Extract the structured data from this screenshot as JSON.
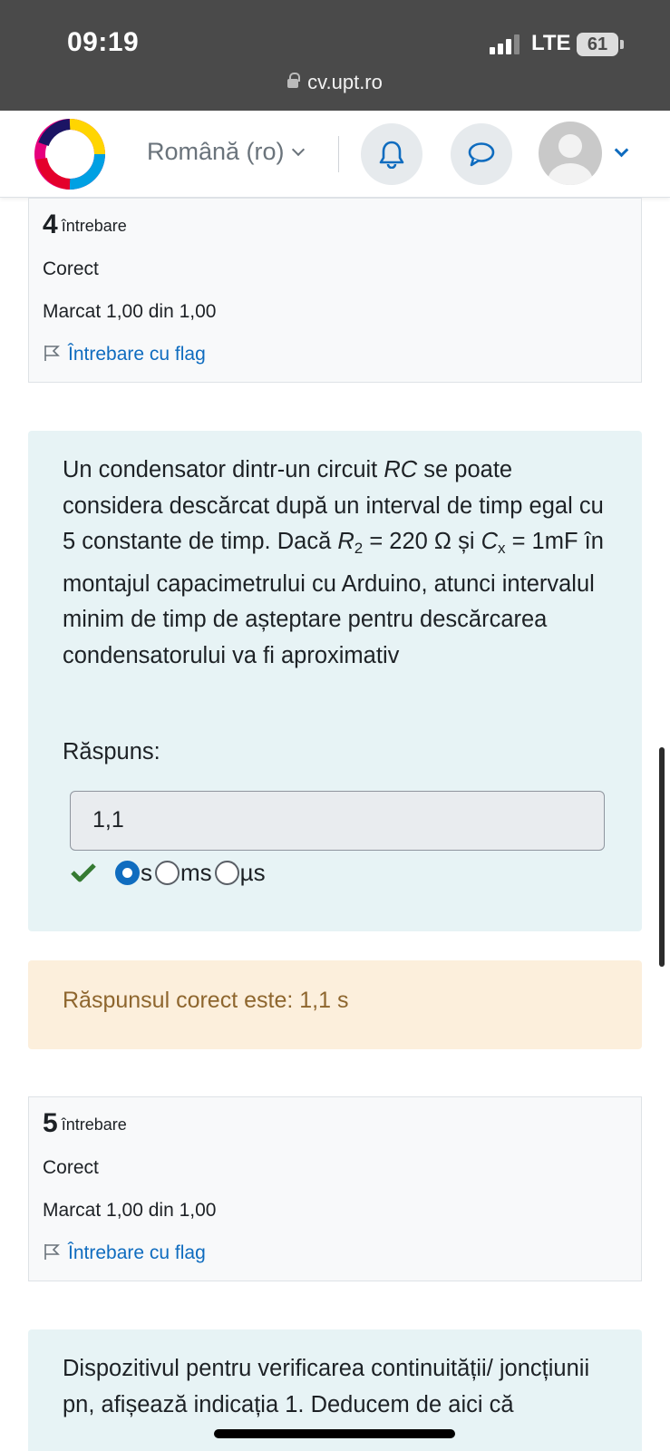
{
  "status": {
    "time": "09:19",
    "network": "LTE",
    "battery": "61",
    "url": "cv.upt.ro"
  },
  "nav": {
    "language": "Română (ro)"
  },
  "q4": {
    "number": "4",
    "label": "întrebare",
    "state": "Corect",
    "grade": "Marcat 1,00 din 1,00",
    "flag": "Întrebare cu flag",
    "text_a": "Un condensator dintr-un circuit ",
    "text_rc": "RC",
    "text_b": " se poate considera descărcat după un interval de timp egal cu 5 constante de timp. Dacă ",
    "r_sym": "R",
    "r_sub": "2",
    "text_c": " = 220 Ω și ",
    "c_sym": "C",
    "c_sub": "x",
    "text_d": " = 1mF în montajul capacimetrului cu Arduino, atunci intervalul minim de timp de așteptare pentru descărcarea condensatorului va fi aproximativ",
    "answer_label": "Răspuns:",
    "answer_value": "1,1",
    "units": [
      "s",
      "ms",
      "µs"
    ],
    "selected_unit": "s",
    "feedback": "Răspunsul corect este: 1,1 s"
  },
  "q5": {
    "number": "5",
    "label": "întrebare",
    "state": "Corect",
    "grade": "Marcat 1,00 din 1,00",
    "flag": "Întrebare cu flag",
    "text": "Dispozitivul pentru verificarea  continuității/ joncțiunii pn,  afișează indicația 1. Deducem de aici că"
  },
  "colors": {
    "accent": "#0f6cbf",
    "question_bg": "#e7f3f5",
    "feedback_bg": "#fcefdc",
    "correct": "#357a32"
  }
}
